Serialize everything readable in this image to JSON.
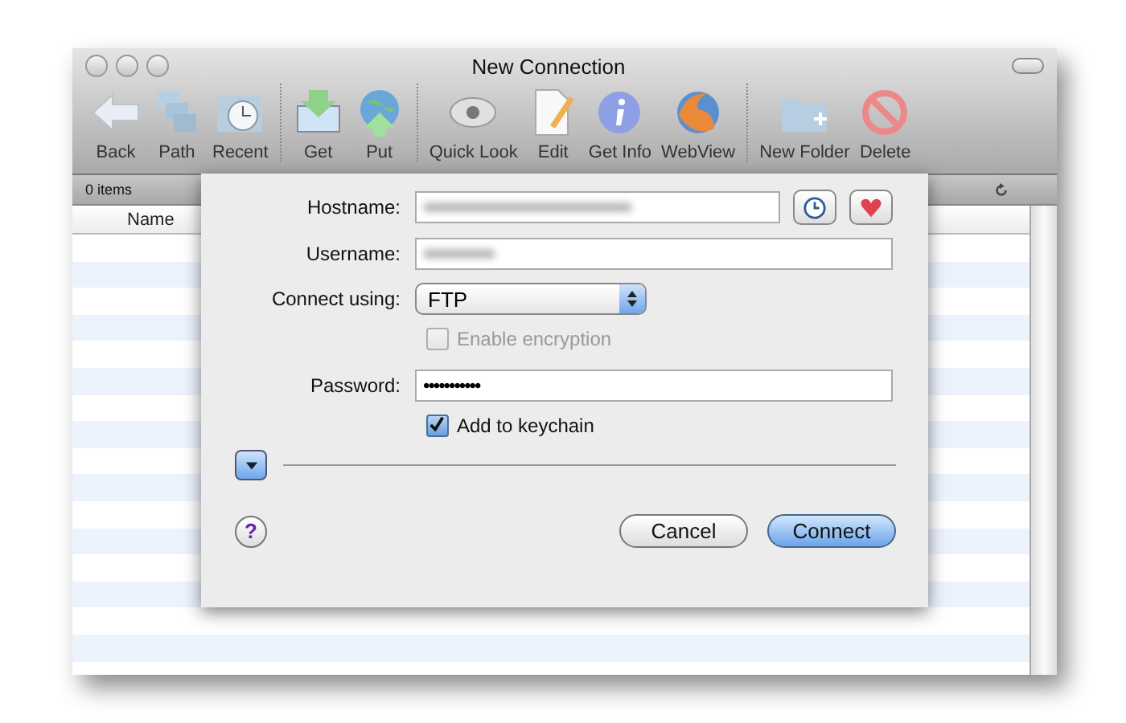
{
  "window": {
    "title": "New Connection"
  },
  "toolbar": {
    "groups": [
      [
        {
          "kind": "back",
          "label": "Back"
        },
        {
          "kind": "path",
          "label": "Path"
        },
        {
          "kind": "recent",
          "label": "Recent"
        }
      ],
      [
        {
          "kind": "get",
          "label": "Get"
        },
        {
          "kind": "put",
          "label": "Put"
        }
      ],
      [
        {
          "kind": "quicklook",
          "label": "Quick Look"
        },
        {
          "kind": "edit",
          "label": "Edit"
        },
        {
          "kind": "info",
          "label": "Get Info"
        },
        {
          "kind": "web",
          "label": "WebView"
        }
      ],
      [
        {
          "kind": "newfolder",
          "label": "New Folder"
        },
        {
          "kind": "delete",
          "label": "Delete"
        }
      ]
    ]
  },
  "browser": {
    "item_count": "0 items",
    "columns": [
      "Name"
    ]
  },
  "dialog": {
    "hostname": {
      "label": "Hostname:",
      "value_blurred": true
    },
    "username": {
      "label": "Username:",
      "value_blurred": true
    },
    "protocol": {
      "label": "Connect using:",
      "value": "FTP"
    },
    "encryption": {
      "label": "Enable encryption",
      "checked": false,
      "disabled": true
    },
    "password": {
      "label": "Password:",
      "value": "•••••••••••"
    },
    "keychain": {
      "label": "Add to keychain",
      "checked": true,
      "disabled": false
    },
    "options_expanded": false,
    "help_button": {
      "label": "?"
    },
    "buttons": [
      {
        "label": "Cancel",
        "default": false
      },
      {
        "label": "Connect",
        "default": true
      }
    ]
  }
}
